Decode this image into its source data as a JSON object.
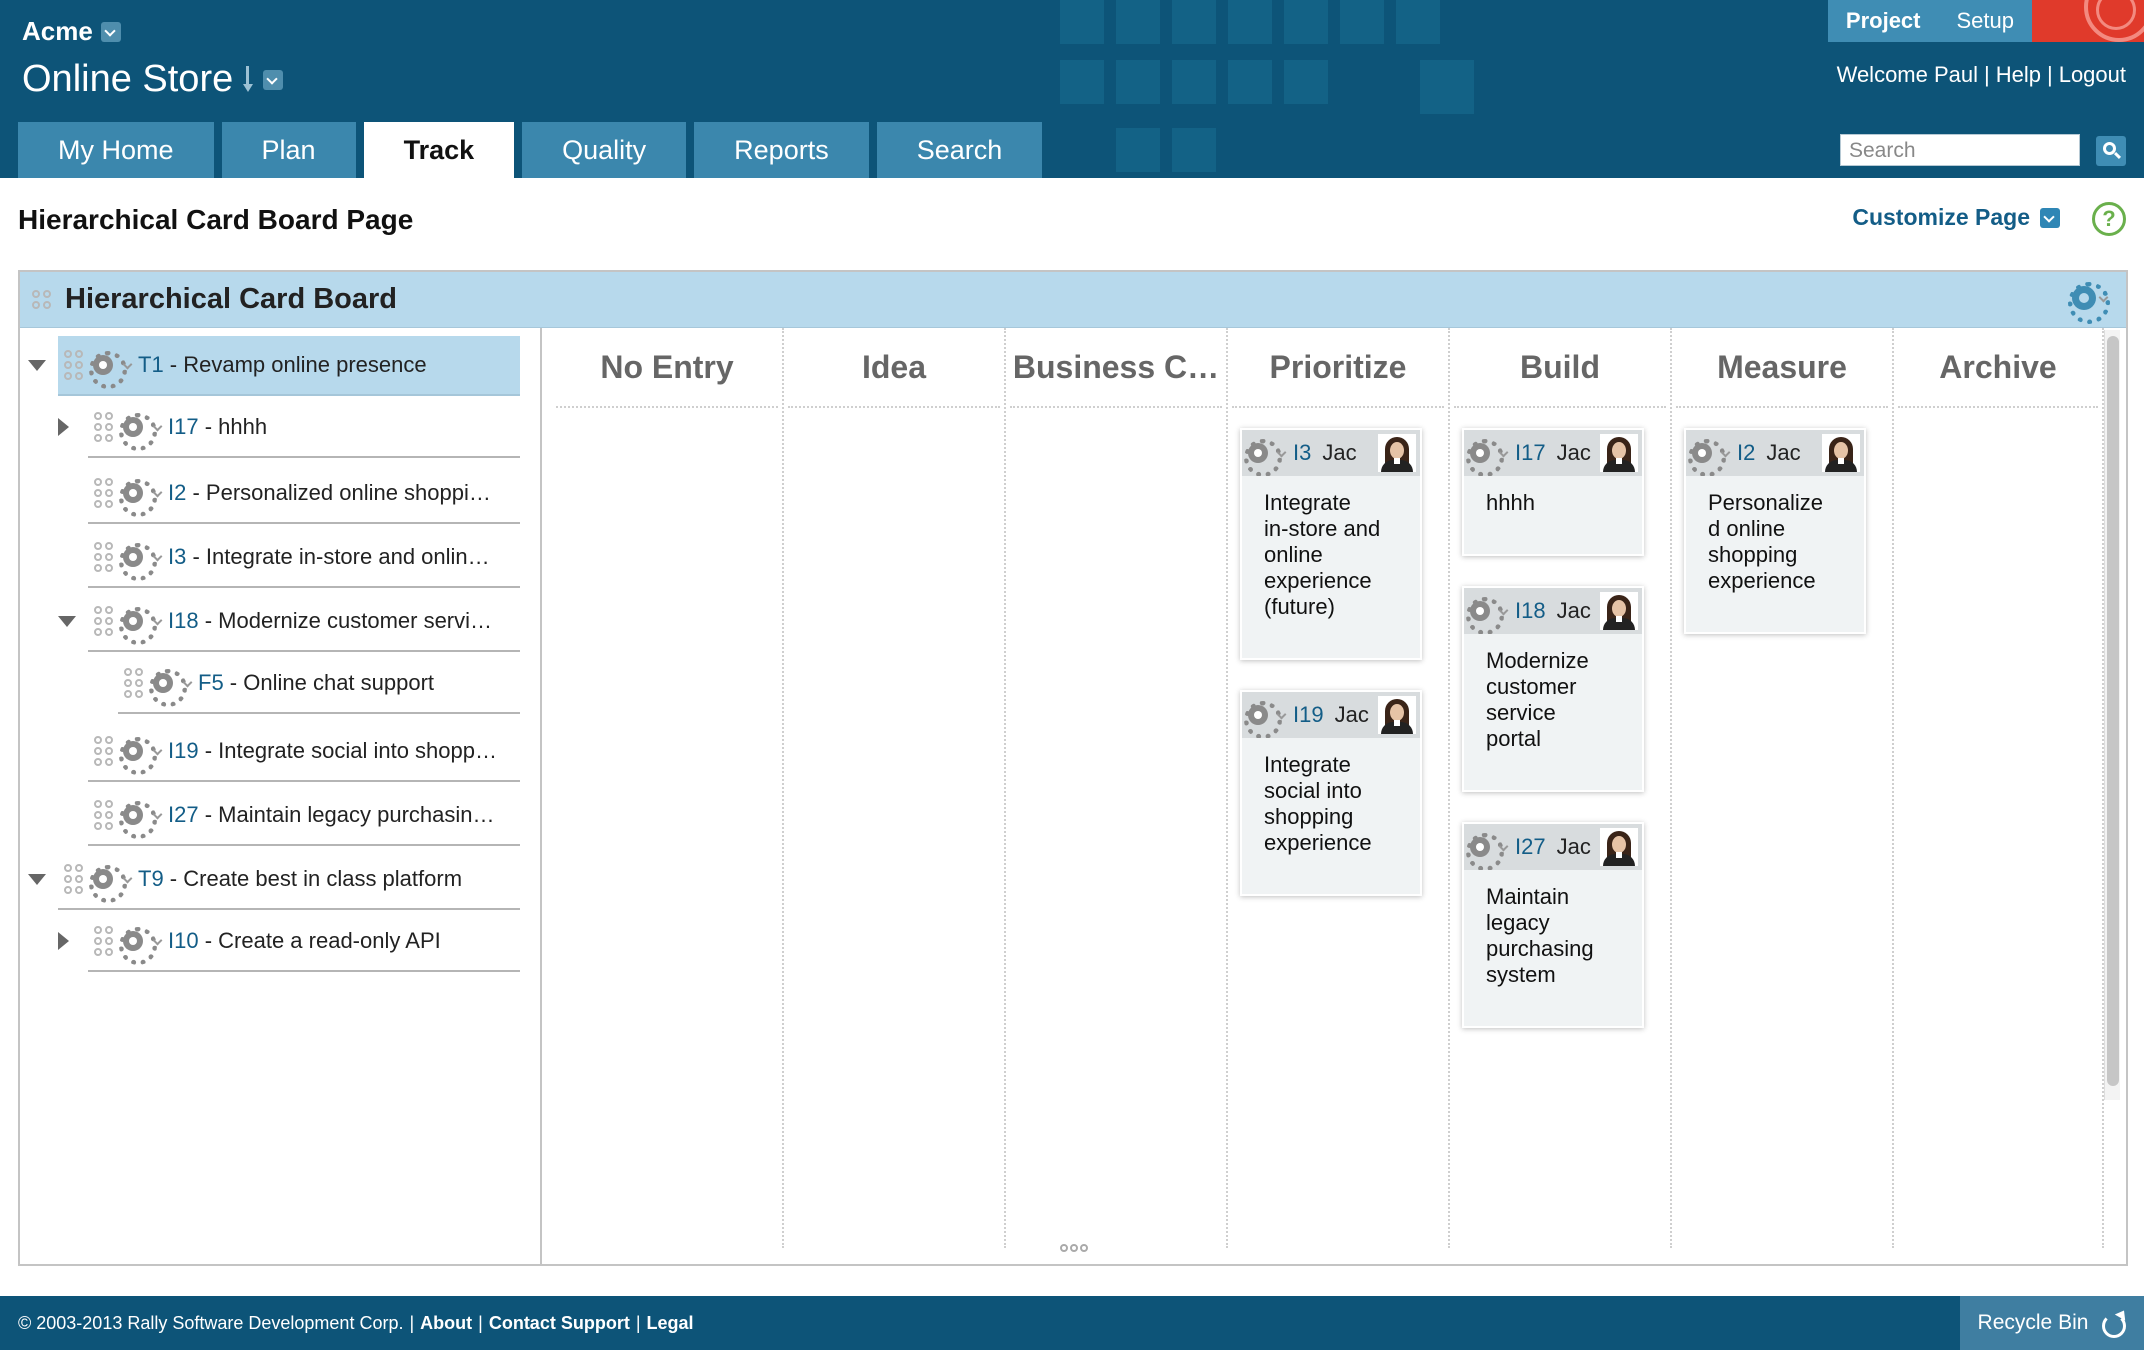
{
  "header": {
    "workspace": "Acme",
    "project": "Online Store",
    "top_tabs": [
      "Project",
      "Setup"
    ],
    "welcome": "Welcome Paul",
    "links": [
      "Help",
      "Logout"
    ],
    "separator": "|",
    "nav_tabs": [
      "My Home",
      "Plan",
      "Track",
      "Quality",
      "Reports",
      "Search"
    ],
    "active_nav": "Track",
    "search_placeholder": "Search"
  },
  "page": {
    "title": "Hierarchical Card Board Page",
    "customize_label": "Customize Page",
    "help_symbol": "?"
  },
  "board": {
    "title": "Hierarchical Card Board",
    "tree": [
      {
        "id": "T1",
        "title": "Revamp online presence",
        "toggle": "expanded",
        "selected": true
      },
      {
        "id": "I17",
        "title": "hhhh",
        "toggle": "collapsed"
      },
      {
        "id": "I2",
        "title": "Personalized online shoppi…",
        "toggle": "none"
      },
      {
        "id": "I3",
        "title": "Integrate in-store and onlin…",
        "toggle": "none"
      },
      {
        "id": "I18",
        "title": "Modernize customer servi…",
        "toggle": "expanded"
      },
      {
        "id": "F5",
        "title": "Online chat support",
        "toggle": "none"
      },
      {
        "id": "I19",
        "title": "Integrate social into shopp…",
        "toggle": "none"
      },
      {
        "id": "I27",
        "title": "Maintain legacy purchasin…",
        "toggle": "none"
      },
      {
        "id": "T9",
        "title": "Create best in class platform",
        "toggle": "expanded"
      },
      {
        "id": "I10",
        "title": "Create a read-only API",
        "toggle": "collapsed"
      }
    ],
    "columns": [
      "No Entry",
      "Idea",
      "Business C…",
      "Prioritize",
      "Build",
      "Measure",
      "Archive"
    ],
    "cards": [
      {
        "column": "Prioritize",
        "id": "I3",
        "owner": "Jac",
        "lines": [
          "Integrate",
          "in-store and",
          "online",
          "experience",
          "(future)"
        ]
      },
      {
        "column": "Prioritize",
        "id": "I19",
        "owner": "Jac",
        "lines": [
          "Integrate",
          "social into",
          "shopping",
          "experience"
        ]
      },
      {
        "column": "Build",
        "id": "I17",
        "owner": "Jac",
        "lines": [
          "hhhh"
        ]
      },
      {
        "column": "Build",
        "id": "I18",
        "owner": "Jac",
        "lines": [
          "Modernize",
          "customer",
          "service",
          "portal"
        ]
      },
      {
        "column": "Build",
        "id": "I27",
        "owner": "Jac",
        "lines": [
          "Maintain",
          "legacy",
          "purchasing",
          "system"
        ]
      },
      {
        "column": "Measure",
        "id": "I2",
        "owner": "Jac",
        "lines": [
          "Personalize",
          "d online",
          "shopping",
          "experience"
        ]
      }
    ]
  },
  "footer": {
    "copyright": "© 2003-2013 Rally Software Development Corp.",
    "links": [
      "About",
      "Contact Support",
      "Legal"
    ],
    "recycle_bin": "Recycle Bin"
  },
  "colors": {
    "header_bg": "#0d5478",
    "tab_bg": "#3b87ad",
    "board_header_bg": "#b7d9ec",
    "link": "#135d87",
    "brand_red": "#e03a2b"
  }
}
